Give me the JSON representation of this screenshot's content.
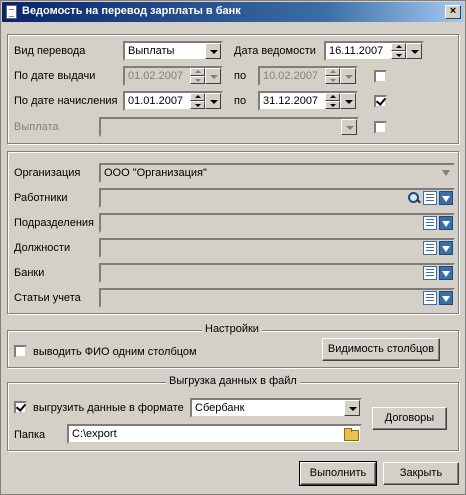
{
  "window": {
    "title": "Ведомость на перевод зарплаты в банк",
    "close": "×"
  },
  "transfer": {
    "type_label": "Вид перевода",
    "type_value": "Выплаты",
    "statement_date_label": "Дата ведомости",
    "statement_date": "16.11.2007",
    "issue_date_label": "По дате выдачи",
    "issue_from": "01.02.2007",
    "issue_to_label": "по",
    "issue_to": "10.02.2007",
    "issue_checked": false,
    "accrual_date_label": "По дате начисления",
    "accrual_from": "01.01.2007",
    "accrual_to_label": "по",
    "accrual_to": "31.12.2007",
    "accrual_checked": true,
    "payment_label": "Выплата",
    "payment_value": "",
    "payment_checked": false
  },
  "filters": {
    "organization_label": "Организация",
    "organization_value": "ООО \"Организация\"",
    "employees_label": "Работники",
    "departments_label": "Подразделения",
    "positions_label": "Должности",
    "banks_label": "Банки",
    "accounts_label": "Статьи учета"
  },
  "settings": {
    "title": "Настройки",
    "fio_one_column_label": "выводить ФИО одним столбцом",
    "fio_one_column_checked": false,
    "columns_visibility_button": "Видимость столбцов"
  },
  "export": {
    "title": "Выгрузка данных в файл",
    "export_format_label": "выгрузить данные в формате",
    "export_checked": true,
    "format_value": "Сбербанк",
    "contracts_button": "Договоры",
    "folder_label": "Папка",
    "folder_value": "C:\\export"
  },
  "footer": {
    "execute_button": "Выполнить",
    "close_button": "Закрыть"
  }
}
